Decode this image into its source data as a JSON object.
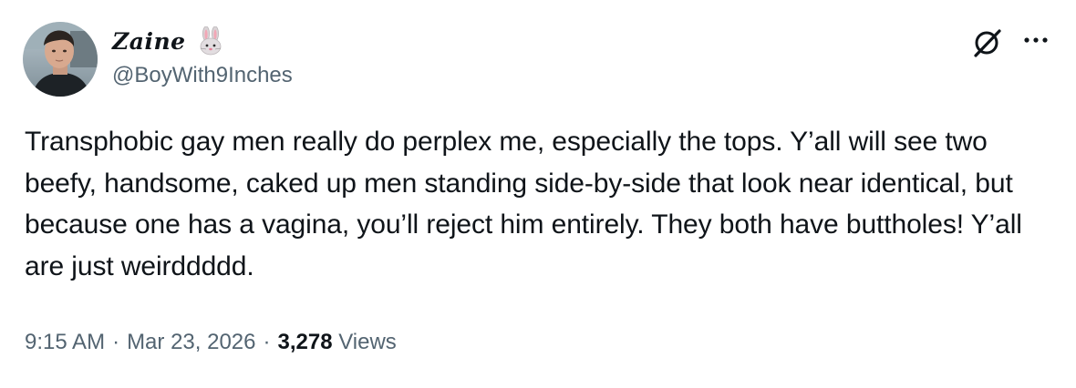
{
  "author": {
    "display_name": "Zaine",
    "name_emoji": "rabbit-face-icon",
    "handle": "@BoyWith9Inches"
  },
  "tweet": {
    "text": "Transphobic gay men really do perplex me, especially the tops. Y’all will see two beefy, handsome, caked up men standing side-by-side that look near identical, but because one has a vagina, you’ll reject him entirely. They both have buttholes! Y’all are just weirddddd."
  },
  "meta": {
    "time": "9:15 AM",
    "separator": "·",
    "date": "Mar 23, 2026",
    "views_count": "3,278",
    "views_label": "Views"
  },
  "icons": {
    "grok": "grok-icon",
    "more": "more-options-icon"
  },
  "colors": {
    "text_primary": "#0f1419",
    "text_secondary": "#536471",
    "background": "#ffffff"
  }
}
